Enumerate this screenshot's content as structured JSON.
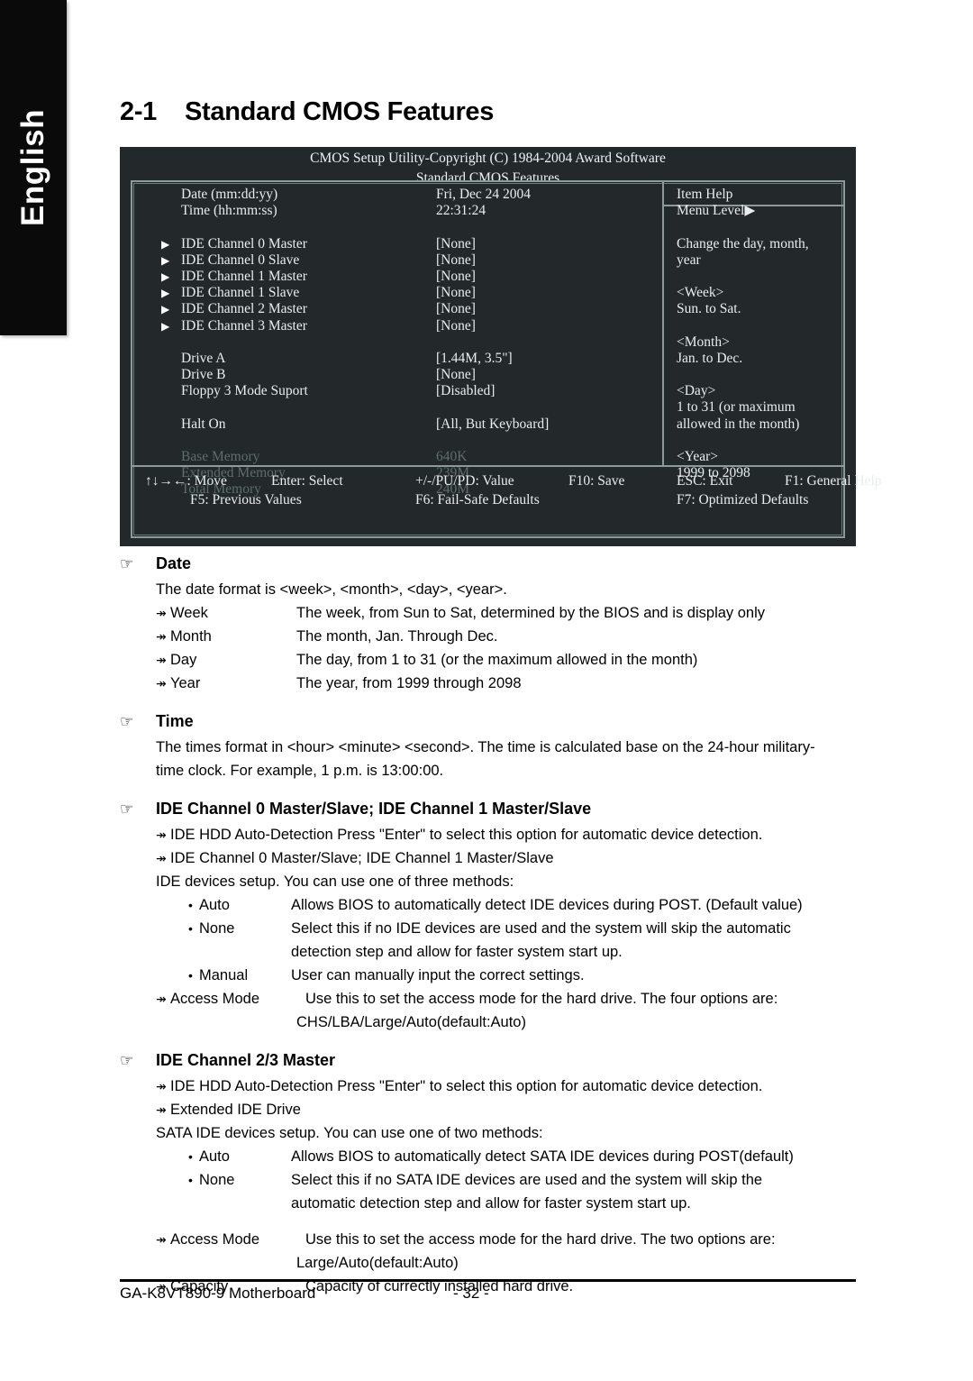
{
  "sidebar": {
    "language_tab": "English"
  },
  "heading": {
    "number": "2-1",
    "title": "Standard CMOS Features"
  },
  "bios": {
    "title_line1": "CMOS Setup Utility-Copyright (C) 1984-2004 Award Software",
    "title_line2": "Standard CMOS Features",
    "rows": [
      {
        "arrow": "",
        "label": "Date (mm:dd:yy)",
        "value": "Fri, Dec  24  2004"
      },
      {
        "arrow": "",
        "label": "Time (hh:mm:ss)",
        "value": "22:31:24"
      },
      {
        "arrow": "▶",
        "label": "IDE Channel 0 Master",
        "value": "[None]"
      },
      {
        "arrow": "▶",
        "label": "IDE Channel 0 Slave",
        "value": "[None]"
      },
      {
        "arrow": "▶",
        "label": "IDE Channel 1 Master",
        "value": "[None]"
      },
      {
        "arrow": "▶",
        "label": "IDE Channel 1 Slave",
        "value": "[None]"
      },
      {
        "arrow": "▶",
        "label": "IDE Channel 2 Master",
        "value": "[None]"
      },
      {
        "arrow": "▶",
        "label": "IDE Channel 3 Master",
        "value": "[None]"
      },
      {
        "arrow": "",
        "label": "Drive A",
        "value": "[1.44M, 3.5\"]"
      },
      {
        "arrow": "",
        "label": "Drive B",
        "value": "[None]"
      },
      {
        "arrow": "",
        "label": "Floppy 3 Mode Suport",
        "value": "[Disabled]"
      },
      {
        "arrow": "",
        "label": "Halt On",
        "value": "[All, But Keyboard]"
      },
      {
        "arrow": "",
        "label": "Base Memory",
        "value": "640K"
      },
      {
        "arrow": "",
        "label": "Extended Memory",
        "value": "239M"
      },
      {
        "arrow": "",
        "label": "Total Memory",
        "value": "240M"
      }
    ],
    "help": {
      "header": "Item Help",
      "menu_level": "Menu Level",
      "menu_level_arrow": "▶",
      "lines": [
        "Change the day, month,",
        "year",
        "<Week>",
        "Sun. to Sat.",
        "<Month>",
        "Jan. to Dec.",
        "<Day>",
        "1 to 31 (or maximum",
        "allowed in the month)",
        "<Year>",
        "1999 to 2098"
      ]
    },
    "footer": {
      "row1": [
        "↑↓→←: Move",
        "Enter: Select",
        "+/-/PU/PD: Value",
        "F10: Save",
        "ESC: Exit",
        "F1: General Help"
      ],
      "row2": [
        "F5: Previous Values",
        "F6: Fail-Safe Defaults",
        "F7: Optimized Defaults"
      ]
    }
  },
  "icons": {
    "hand": "☞",
    "dbl_arrow": "↠",
    "bullet": "•"
  },
  "sections": [
    {
      "title": "Date",
      "intro": "The date format is <week>, <month>, <day>, <year>.",
      "items": [
        {
          "term": "Week",
          "desc": "The week, from Sun to Sat, determined by the BIOS and is display only"
        },
        {
          "term": "Month",
          "desc": "The month, Jan. Through Dec."
        },
        {
          "term": "Day",
          "desc": "The day, from 1 to 31 (or the maximum allowed in the month)"
        },
        {
          "term": "Year",
          "desc": "The year, from 1999 through 2098"
        }
      ]
    },
    {
      "title": "Time",
      "para1": "The times format in <hour> <minute> <second>. The time is calculated base on the 24-hour military-",
      "para2": "time clock. For example, 1 p.m. is 13:00:00."
    },
    {
      "title": "IDE Channel 0 Master/Slave; IDE Channel 1 Master/Slave",
      "sub1": "IDE HDD Auto-Detection Press \"Enter\" to select this option for automatic device detection.",
      "sub2": "IDE Channel 0 Master/Slave; IDE Channel 1 Master/Slave",
      "intro": "IDE devices setup.  You can use one of three methods:",
      "options": [
        {
          "term": "Auto",
          "desc": "Allows BIOS to automatically detect IDE devices during POST. (Default value)",
          "desc2": ""
        },
        {
          "term": "None",
          "desc": "Select this if no IDE devices are used and the system will skip the automatic",
          "desc2": "detection step and allow for faster system start up."
        },
        {
          "term": "Manual",
          "desc": "User can manually input the correct settings.",
          "desc2": ""
        }
      ],
      "access_mode_term": "Access Mode",
      "access_mode_desc": "Use this to set the access mode for the hard drive. The four options are:",
      "access_mode_desc2": "CHS/LBA/Large/Auto(default:Auto)"
    },
    {
      "title": "IDE Channel 2/3 Master",
      "sub1": "IDE HDD Auto-Detection Press \"Enter\" to select this option for automatic device detection.",
      "sub2": "Extended IDE Drive",
      "intro": "SATA IDE devices setup. You can use one of two methods:",
      "options": [
        {
          "term": "Auto",
          "desc": "Allows BIOS to automatically detect SATA IDE devices during POST(default)",
          "desc2": ""
        },
        {
          "term": "None",
          "desc": "Select this if no SATA IDE devices are used and the system will skip the",
          "desc2": "automatic detection step and allow for faster system start up."
        }
      ],
      "access_mode_term": "Access Mode",
      "access_mode_desc": "Use this to set the access mode for the hard drive. The two options are:",
      "access_mode_desc2": "Large/Auto(default:Auto)",
      "capacity_term": "Capacity",
      "capacity_desc": "Capacity of currectly installed hard drive."
    }
  ],
  "page_footer": {
    "motherboard": "GA-K8VT890-9 Motherboard",
    "page_number": "- 32 -"
  }
}
